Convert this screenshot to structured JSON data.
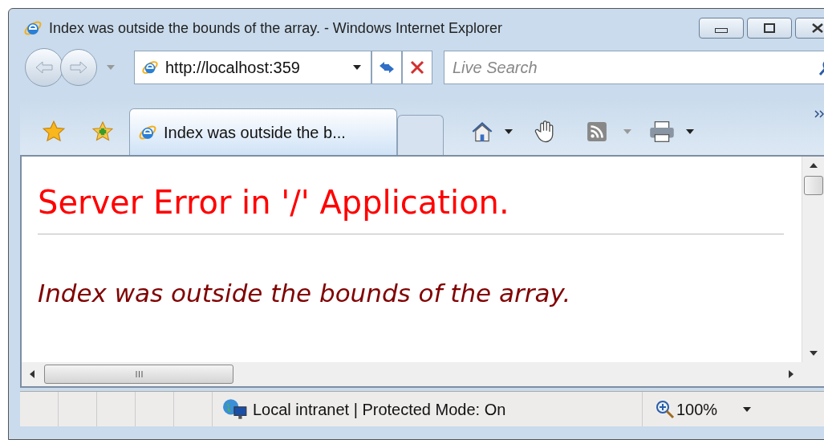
{
  "window": {
    "title": "Index was outside the bounds of the array. - Windows Internet Explorer"
  },
  "address_bar": {
    "value": "http://localhost:359"
  },
  "search": {
    "placeholder": "Live Search"
  },
  "tabs": [
    {
      "label": "Index was outside the b...",
      "selected": true
    }
  ],
  "page": {
    "heading": "Server Error in '/' Application.",
    "message": "Index was outside the bounds of the array."
  },
  "status_bar": {
    "zone": "Local intranet | Protected Mode: On",
    "zoom": "100%"
  }
}
